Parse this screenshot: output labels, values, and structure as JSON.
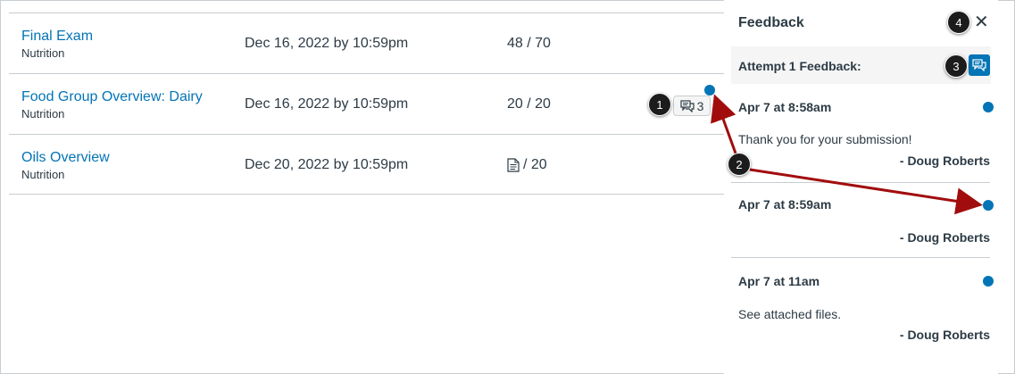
{
  "grades": {
    "rows": [
      {
        "assignment": "Final Exam",
        "course": "Nutrition",
        "due": "Dec 16, 2022 by 10:59pm",
        "score": "48 / 70",
        "score_icon": ""
      },
      {
        "assignment": "Food Group Overview: Dairy",
        "course": "Nutrition",
        "due": "Dec 16, 2022 by 10:59pm",
        "score": "20 / 20",
        "comment_count": "3"
      },
      {
        "assignment": "Oils Overview",
        "course": "Nutrition",
        "due": "Dec 20, 2022 by 10:59pm",
        "score": "/ 20",
        "score_icon": "submission-document-icon"
      }
    ]
  },
  "tray": {
    "title": "Feedback",
    "close_label": "✕",
    "attempt_label": "Attempt 1 Feedback:",
    "comments": [
      {
        "date": "Apr 7 at 8:58am",
        "message": "Thank you for your submission!",
        "author": "- Doug Roberts"
      },
      {
        "date": "Apr 7 at 8:59am",
        "message": "",
        "author": "- Doug Roberts"
      },
      {
        "date": "Apr 7 at 11am",
        "message": "See attached files.",
        "author": "- Doug Roberts"
      }
    ]
  },
  "callouts": [
    "1",
    "2",
    "3",
    "4"
  ],
  "colors": {
    "link": "#0374b5",
    "text": "#2d3b45",
    "border": "#c7cdd1",
    "arrow": "#a10d0d",
    "callout": "#1c1c1c"
  }
}
